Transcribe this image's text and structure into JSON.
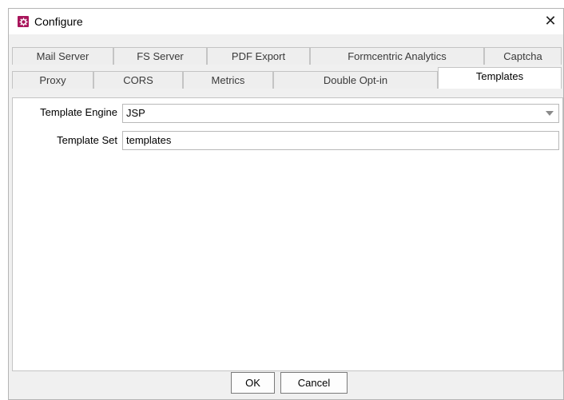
{
  "window": {
    "title": "Configure",
    "icon": "gear-icon",
    "close_glyph": "✕",
    "accent": "#a8155b"
  },
  "tabs": {
    "row1": [
      {
        "label": "Mail Server"
      },
      {
        "label": "FS Server"
      },
      {
        "label": "PDF Export"
      },
      {
        "label": "Formcentric Analytics"
      },
      {
        "label": "Captcha"
      }
    ],
    "row2": [
      {
        "label": "Proxy"
      },
      {
        "label": "CORS"
      },
      {
        "label": "Metrics"
      },
      {
        "label": "Double Opt-in"
      },
      {
        "label": "Templates"
      }
    ],
    "active": "Templates"
  },
  "form": {
    "engine": {
      "label": "Template Engine",
      "value": "JSP"
    },
    "set": {
      "label": "Template Set",
      "value": "templates"
    }
  },
  "buttons": {
    "ok": "OK",
    "cancel": "Cancel"
  }
}
